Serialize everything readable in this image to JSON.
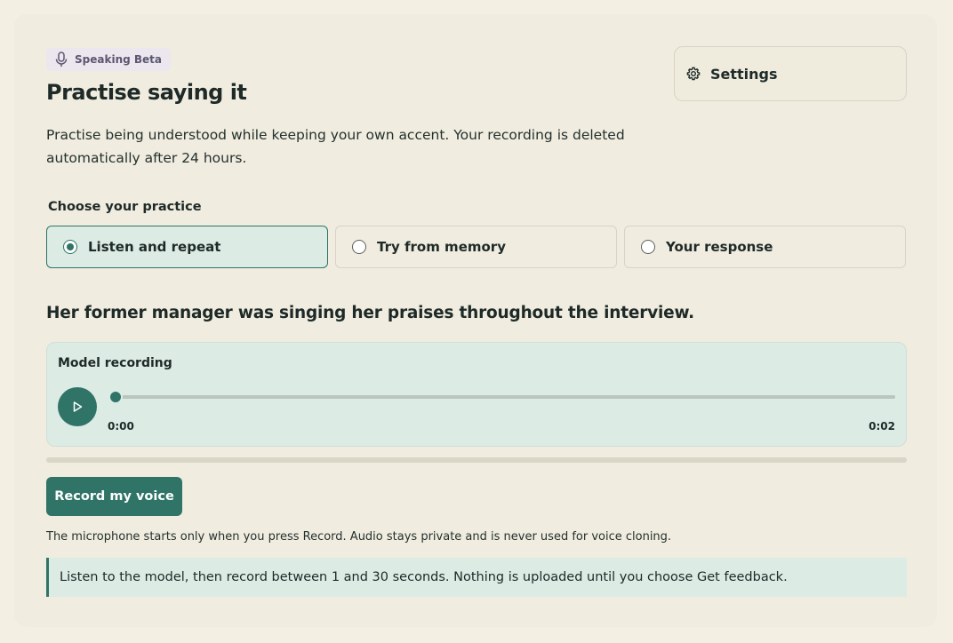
{
  "header": {
    "badge_label": "Speaking Beta",
    "badge_icon": "microphone-icon",
    "title": "Practise saying it",
    "description": "Practise being understood while keeping your own accent. Your recording is deleted automatically after 24 hours."
  },
  "settings": {
    "label": "Settings",
    "icon": "gear-icon"
  },
  "practice": {
    "label": "Choose your practice",
    "options": [
      {
        "label": "Listen and repeat",
        "selected": true
      },
      {
        "label": "Try from memory",
        "selected": false
      },
      {
        "label": "Your response",
        "selected": false
      }
    ]
  },
  "sentence": "Her former manager was singing her praises throughout the interview.",
  "player": {
    "label": "Model recording",
    "current_time": "0:00",
    "duration": "0:02",
    "progress": 0
  },
  "record": {
    "button_label": "Record my voice",
    "level": 0,
    "note": "The microphone starts only when you press Record. Audio stays private and is never used for voice cloning."
  },
  "info": "Listen to the model, then record between 1 and 30 seconds. Nothing is uploaded until you choose Get feedback.",
  "colors": {
    "accent": "#2f7467",
    "selected_bg": "#dcebe4",
    "page_bg": "#f4efe3"
  }
}
